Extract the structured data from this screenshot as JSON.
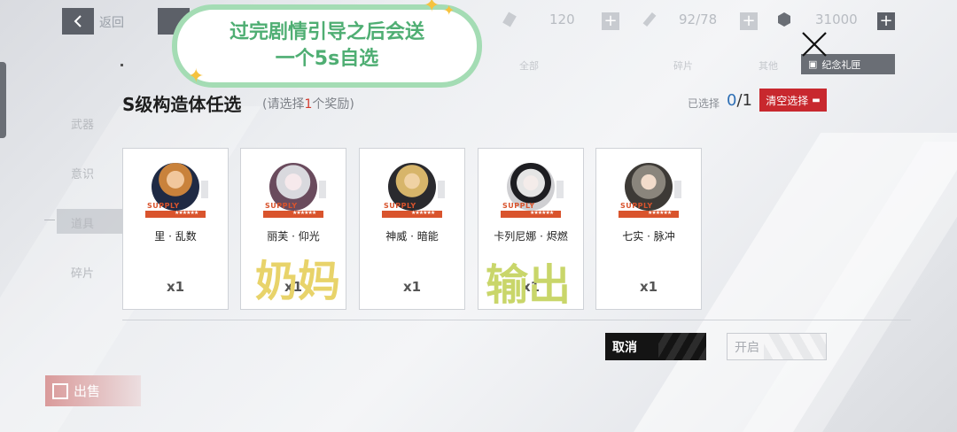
{
  "topbar": {
    "back_label": "返回",
    "resources": [
      {
        "icon": "stamina-icon",
        "value": "120"
      },
      {
        "icon": "key-icon",
        "value": "92/78"
      },
      {
        "icon": "coin-icon",
        "value": "31000"
      }
    ]
  },
  "filters": [
    "全部",
    "碎片",
    "其他"
  ],
  "gift_button": "纪念礼匣",
  "side_nav": [
    "武器",
    "意识",
    "道具",
    "碎片"
  ],
  "dialog": {
    "title": "S级构造体任选",
    "hint_prefix": "(请选择",
    "hint_count": "1",
    "hint_suffix": "个奖励)",
    "selected_label": "已选择",
    "selected_current": "0",
    "selected_total": "/1",
    "clear_label": "清空选择",
    "cancel_label": "取消",
    "open_label": "开启"
  },
  "cards": [
    {
      "name": "里 · 乱数",
      "qty": "x1",
      "supply": "SUPPLY",
      "stars": "★★★★★★"
    },
    {
      "name": "丽芙 · 仰光",
      "qty": "x1",
      "supply": "SUPPLY",
      "stars": "★★★★★★"
    },
    {
      "name": "神威 · 暗能",
      "qty": "x1",
      "supply": "SUPPLY",
      "stars": "★★★★★★"
    },
    {
      "name": "卡列尼娜 · 烬燃",
      "qty": "x1",
      "supply": "SUPPLY",
      "stars": "★★★★★★"
    },
    {
      "name": "七实 · 脉冲",
      "qty": "x1",
      "supply": "SUPPLY",
      "stars": "★★★★★★"
    }
  ],
  "sell_label": "出售",
  "annotations": {
    "bubble_line1": "过完剧情引导之后会送",
    "bubble_line2": "一个5s自选",
    "note_healer": "奶妈",
    "note_dps": "输出",
    "healer_color": "#e8d36a",
    "dps_color": "#c9d66a"
  },
  "colors": {
    "accent_red": "#c8282e",
    "supply_orange": "#d9542d",
    "bubble_green": "#4fae73"
  }
}
